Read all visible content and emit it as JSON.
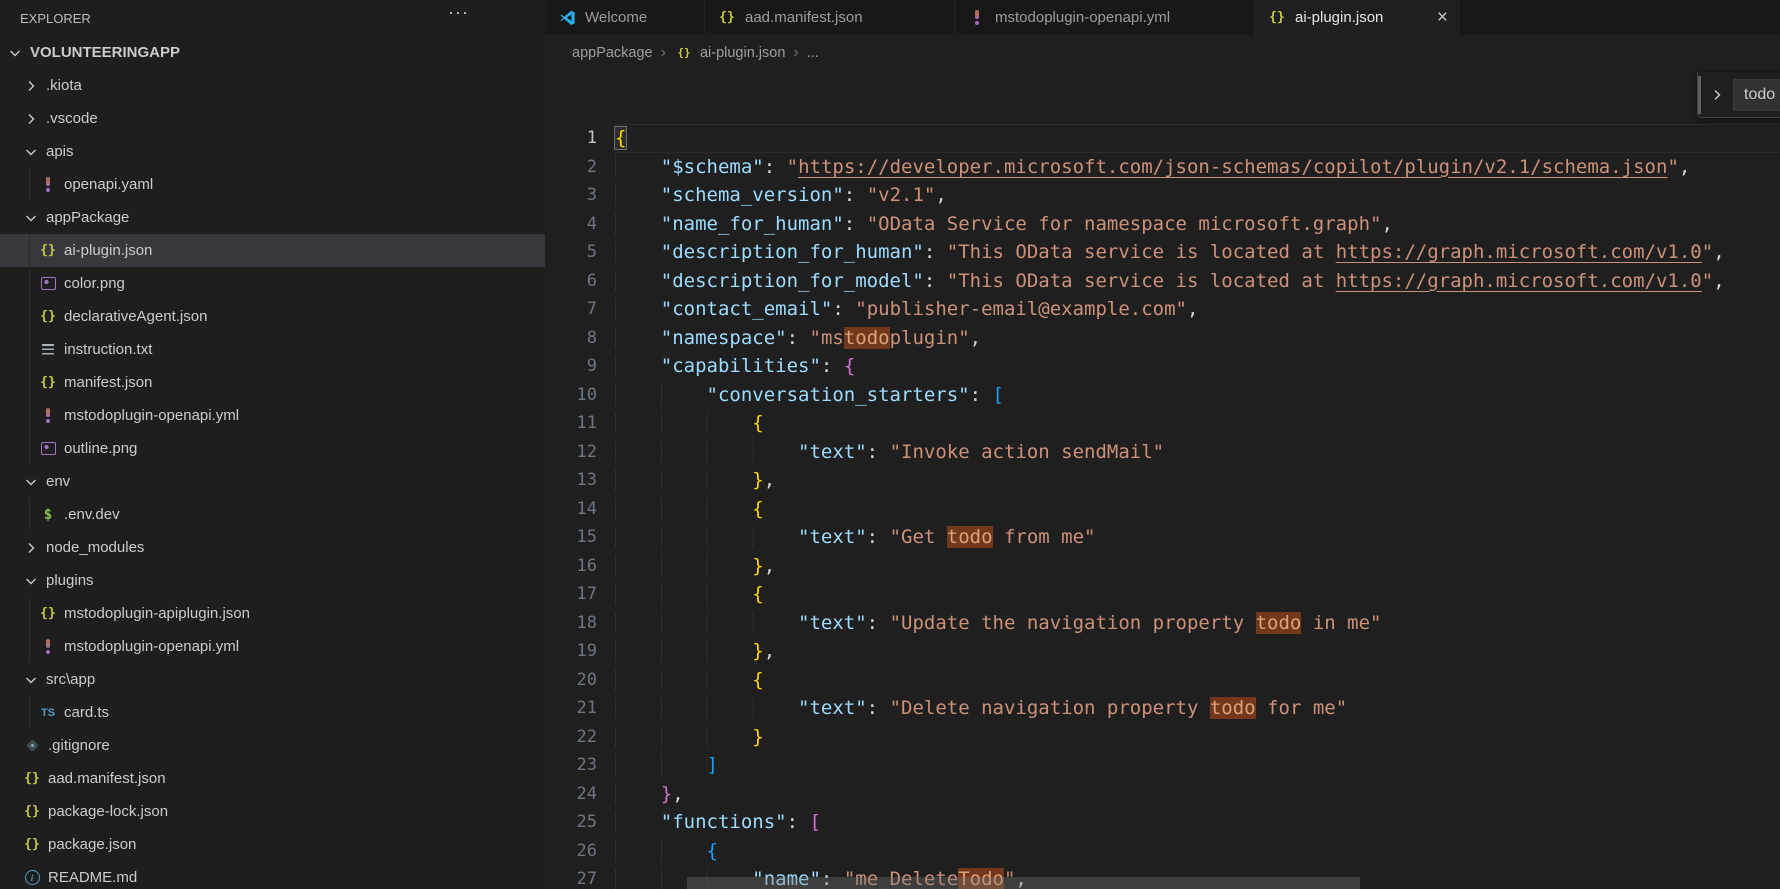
{
  "colors": {
    "editor_bg": "#1f1f1f",
    "sidebar_bg": "#1e1e1e",
    "tabstrip_bg": "#181818",
    "selected_row_bg": "#37373d",
    "match_highlight": "#73381b",
    "json_key": "#9cdcfe",
    "json_string": "#ce9178",
    "bracket1": "#ffd700",
    "bracket2": "#da70d6",
    "bracket3": "#179fff",
    "json_icon": "#cbcb41",
    "yml_icon": "#a46cc8",
    "ts_icon": "#519aba",
    "env_icon": "#8dc149"
  },
  "explorer": {
    "title": "EXPLORER",
    "actions_icon": "ellipsis",
    "root": {
      "label": "VOLUNTEERINGAPP",
      "expanded": true
    },
    "items": [
      {
        "label": ".kiota",
        "kind": "folder",
        "level": 1,
        "expanded": false
      },
      {
        "label": ".vscode",
        "kind": "folder",
        "level": 1,
        "expanded": false
      },
      {
        "label": "apis",
        "kind": "folder",
        "level": 1,
        "expanded": true
      },
      {
        "label": "openapi.yaml",
        "kind": "file",
        "icon": "yml",
        "level": 2
      },
      {
        "label": "appPackage",
        "kind": "folder",
        "level": 1,
        "expanded": true
      },
      {
        "label": "ai-plugin.json",
        "kind": "file",
        "icon": "json",
        "level": 2,
        "selected": true
      },
      {
        "label": "color.png",
        "kind": "file",
        "icon": "image",
        "level": 2
      },
      {
        "label": "declarativeAgent.json",
        "kind": "file",
        "icon": "json",
        "level": 2
      },
      {
        "label": "instruction.txt",
        "kind": "file",
        "icon": "txt",
        "level": 2
      },
      {
        "label": "manifest.json",
        "kind": "file",
        "icon": "json",
        "level": 2
      },
      {
        "label": "mstodoplugin-openapi.yml",
        "kind": "file",
        "icon": "yml",
        "level": 2
      },
      {
        "label": "outline.png",
        "kind": "file",
        "icon": "image",
        "level": 2
      },
      {
        "label": "env",
        "kind": "folder",
        "level": 1,
        "expanded": true
      },
      {
        "label": ".env.dev",
        "kind": "file",
        "icon": "env",
        "level": 2
      },
      {
        "label": "node_modules",
        "kind": "folder",
        "level": 1,
        "expanded": false
      },
      {
        "label": "plugins",
        "kind": "folder",
        "level": 1,
        "expanded": true
      },
      {
        "label": "mstodoplugin-apiplugin.json",
        "kind": "file",
        "icon": "json",
        "level": 2
      },
      {
        "label": "mstodoplugin-openapi.yml",
        "kind": "file",
        "icon": "yml",
        "level": 2
      },
      {
        "label": "src\\app",
        "kind": "folder",
        "level": 1,
        "expanded": true
      },
      {
        "label": "card.ts",
        "kind": "file",
        "icon": "ts",
        "level": 2
      },
      {
        "label": ".gitignore",
        "kind": "file",
        "icon": "git",
        "level": 1
      },
      {
        "label": "aad.manifest.json",
        "kind": "file",
        "icon": "json",
        "level": 1
      },
      {
        "label": "package-lock.json",
        "kind": "file",
        "icon": "json",
        "level": 1
      },
      {
        "label": "package.json",
        "kind": "file",
        "icon": "json",
        "level": 1
      },
      {
        "label": "README.md",
        "kind": "file",
        "icon": "info",
        "level": 1
      }
    ]
  },
  "tabs": [
    {
      "label": "Welcome",
      "icon": "vscode",
      "active": false
    },
    {
      "label": "aad.manifest.json",
      "icon": "json",
      "active": false
    },
    {
      "label": "mstodoplugin-openapi.yml",
      "icon": "yml",
      "active": false
    },
    {
      "label": "ai-plugin.json",
      "icon": "json",
      "active": true,
      "close_label": "×"
    }
  ],
  "breadcrumb": {
    "separator": "›",
    "items": [
      {
        "label": "appPackage"
      },
      {
        "label": "ai-plugin.json",
        "icon": "json"
      },
      {
        "label": "..."
      }
    ]
  },
  "find": {
    "query": "todo",
    "expand_icon": "chevron-right"
  },
  "editor": {
    "language": "json",
    "lines": [
      {
        "n": 1,
        "current": true,
        "t": [
          [
            "b1m",
            "{"
          ]
        ]
      },
      {
        "n": 2,
        "t": [
          [
            "i",
            "    "
          ],
          [
            "k",
            "\"$schema\""
          ],
          [
            "p",
            ": "
          ],
          [
            "s",
            "\""
          ],
          [
            "u",
            "https://developer.microsoft.com/json-schemas/copilot/plugin/v2.1/schema.json"
          ],
          [
            "s",
            "\""
          ],
          [
            "p",
            ","
          ]
        ]
      },
      {
        "n": 3,
        "t": [
          [
            "i",
            "    "
          ],
          [
            "k",
            "\"schema_version\""
          ],
          [
            "p",
            ": "
          ],
          [
            "s",
            "\"v2.1\""
          ],
          [
            "p",
            ","
          ]
        ]
      },
      {
        "n": 4,
        "t": [
          [
            "i",
            "    "
          ],
          [
            "k",
            "\"name_for_human\""
          ],
          [
            "p",
            ": "
          ],
          [
            "s",
            "\"OData Service for namespace microsoft.graph\""
          ],
          [
            "p",
            ","
          ]
        ]
      },
      {
        "n": 5,
        "t": [
          [
            "i",
            "    "
          ],
          [
            "k",
            "\"description_for_human\""
          ],
          [
            "p",
            ": "
          ],
          [
            "s",
            "\"This OData service is located at "
          ],
          [
            "u",
            "https://graph.microsoft.com/v1.0"
          ],
          [
            "s",
            "\""
          ],
          [
            "p",
            ","
          ]
        ]
      },
      {
        "n": 6,
        "t": [
          [
            "i",
            "    "
          ],
          [
            "k",
            "\"description_for_model\""
          ],
          [
            "p",
            ": "
          ],
          [
            "s",
            "\"This OData service is located at "
          ],
          [
            "u",
            "https://graph.microsoft.com/v1.0"
          ],
          [
            "s",
            "\""
          ],
          [
            "p",
            ","
          ]
        ]
      },
      {
        "n": 7,
        "t": [
          [
            "i",
            "    "
          ],
          [
            "k",
            "\"contact_email\""
          ],
          [
            "p",
            ": "
          ],
          [
            "s",
            "\"publisher-email@example.com\""
          ],
          [
            "p",
            ","
          ]
        ]
      },
      {
        "n": 8,
        "t": [
          [
            "i",
            "    "
          ],
          [
            "k",
            "\"namespace\""
          ],
          [
            "p",
            ": "
          ],
          [
            "s",
            "\"ms"
          ],
          [
            "m",
            "todo"
          ],
          [
            "s",
            "plugin\""
          ],
          [
            "p",
            ","
          ]
        ]
      },
      {
        "n": 9,
        "t": [
          [
            "i",
            "    "
          ],
          [
            "k",
            "\"capabilities\""
          ],
          [
            "p",
            ": "
          ],
          [
            "b2",
            "{"
          ]
        ]
      },
      {
        "n": 10,
        "t": [
          [
            "i",
            "        "
          ],
          [
            "k",
            "\"conversation_starters\""
          ],
          [
            "p",
            ": "
          ],
          [
            "b3",
            "["
          ]
        ]
      },
      {
        "n": 11,
        "t": [
          [
            "i",
            "            "
          ],
          [
            "b1",
            "{"
          ]
        ]
      },
      {
        "n": 12,
        "t": [
          [
            "i",
            "                "
          ],
          [
            "k",
            "\"text\""
          ],
          [
            "p",
            ": "
          ],
          [
            "s",
            "\"Invoke action sendMail\""
          ]
        ]
      },
      {
        "n": 13,
        "t": [
          [
            "i",
            "            "
          ],
          [
            "b1",
            "}"
          ],
          [
            "p",
            ","
          ]
        ]
      },
      {
        "n": 14,
        "t": [
          [
            "i",
            "            "
          ],
          [
            "b1",
            "{"
          ]
        ]
      },
      {
        "n": 15,
        "t": [
          [
            "i",
            "                "
          ],
          [
            "k",
            "\"text\""
          ],
          [
            "p",
            ": "
          ],
          [
            "s",
            "\"Get "
          ],
          [
            "m",
            "todo"
          ],
          [
            "s",
            " from me\""
          ]
        ]
      },
      {
        "n": 16,
        "t": [
          [
            "i",
            "            "
          ],
          [
            "b1",
            "}"
          ],
          [
            "p",
            ","
          ]
        ]
      },
      {
        "n": 17,
        "t": [
          [
            "i",
            "            "
          ],
          [
            "b1",
            "{"
          ]
        ]
      },
      {
        "n": 18,
        "t": [
          [
            "i",
            "                "
          ],
          [
            "k",
            "\"text\""
          ],
          [
            "p",
            ": "
          ],
          [
            "s",
            "\"Update the navigation property "
          ],
          [
            "m",
            "todo"
          ],
          [
            "s",
            " in me\""
          ]
        ]
      },
      {
        "n": 19,
        "t": [
          [
            "i",
            "            "
          ],
          [
            "b1",
            "}"
          ],
          [
            "p",
            ","
          ]
        ]
      },
      {
        "n": 20,
        "t": [
          [
            "i",
            "            "
          ],
          [
            "b1",
            "{"
          ]
        ]
      },
      {
        "n": 21,
        "t": [
          [
            "i",
            "                "
          ],
          [
            "k",
            "\"text\""
          ],
          [
            "p",
            ": "
          ],
          [
            "s",
            "\"Delete navigation property "
          ],
          [
            "m",
            "todo"
          ],
          [
            "s",
            " for me\""
          ]
        ]
      },
      {
        "n": 22,
        "t": [
          [
            "i",
            "            "
          ],
          [
            "b1",
            "}"
          ]
        ]
      },
      {
        "n": 23,
        "t": [
          [
            "i",
            "        "
          ],
          [
            "b3",
            "]"
          ]
        ]
      },
      {
        "n": 24,
        "t": [
          [
            "i",
            "    "
          ],
          [
            "b2",
            "}"
          ],
          [
            "p",
            ","
          ]
        ]
      },
      {
        "n": 25,
        "t": [
          [
            "i",
            "    "
          ],
          [
            "k",
            "\"functions\""
          ],
          [
            "p",
            ": "
          ],
          [
            "b2",
            "["
          ]
        ]
      },
      {
        "n": 26,
        "t": [
          [
            "i",
            "        "
          ],
          [
            "b3",
            "{"
          ]
        ]
      },
      {
        "n": 27,
        "t": [
          [
            "i",
            "            "
          ],
          [
            "k",
            "\"name\""
          ],
          [
            "p",
            ": "
          ],
          [
            "s",
            "\"me_Delete"
          ],
          [
            "m",
            "Todo"
          ],
          [
            "s",
            "\""
          ],
          [
            "p",
            ","
          ]
        ]
      }
    ]
  }
}
